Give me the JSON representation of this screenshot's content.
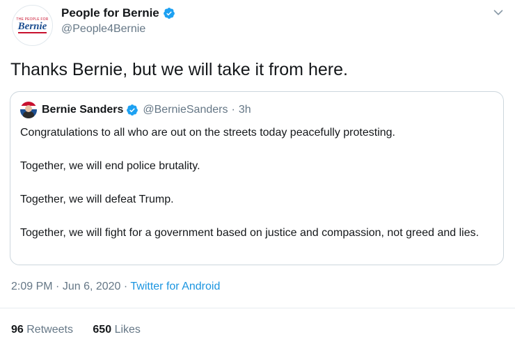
{
  "author": {
    "display_name": "People for Bernie",
    "handle": "@People4Bernie",
    "avatar_text_small": "THE PEOPLE FOR",
    "avatar_text_logo": "Bernie"
  },
  "tweet": {
    "text": "Thanks Bernie, but we will take it from here."
  },
  "quoted_tweet": {
    "display_name": "Bernie Sanders",
    "handle": "@BernieSanders",
    "separator": "·",
    "time": "3h",
    "paragraphs": [
      "Congratulations to all who are out on the streets today peacefully protesting.",
      "Together, we will end police brutality.",
      "Together, we will defeat Trump.",
      "Together, we will fight for a government based on justice and compassion, not greed and lies."
    ]
  },
  "meta": {
    "time": "2:09 PM",
    "separator": "·",
    "date": "Jun 6, 2020",
    "separator2": "·",
    "source": "Twitter for Android"
  },
  "stats": {
    "retweets_count": "96",
    "retweets_label": "Retweets",
    "likes_count": "650",
    "likes_label": "Likes"
  },
  "colors": {
    "verified": "#1da1f2",
    "link": "#1b95e0",
    "secondary_text": "#657786"
  }
}
